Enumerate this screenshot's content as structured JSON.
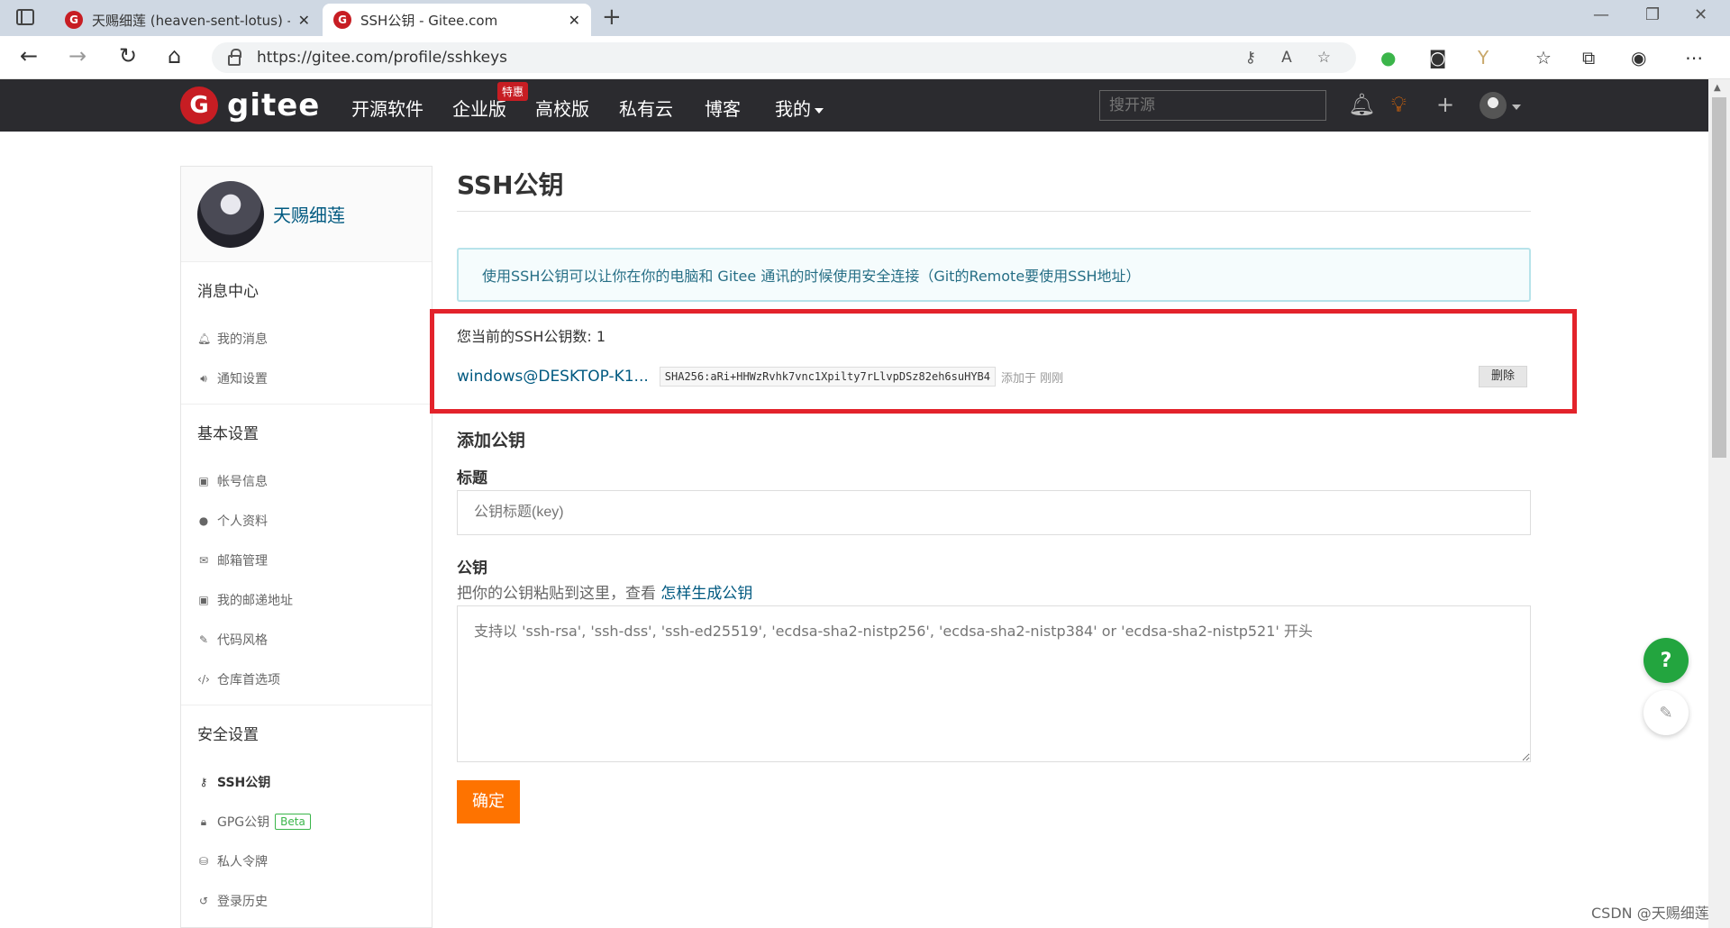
{
  "browser": {
    "tabs": [
      {
        "favicon": "G",
        "title": "天赐细莲 (heaven-sent-lotus) - G"
      },
      {
        "favicon": "G",
        "title": "SSH公钥 - Gitee.com"
      }
    ],
    "url": "https://gitee.com/profile/sshkeys"
  },
  "header": {
    "logo_text": "gitee",
    "nav": [
      "开源软件",
      "企业版",
      "高校版",
      "私有云",
      "博客",
      "我的"
    ],
    "enterprise_badge": "特惠",
    "search_placeholder": "搜开源"
  },
  "sidebar": {
    "username": "天赐细莲",
    "sections": [
      {
        "title": "消息中心",
        "items": [
          "我的消息",
          "通知设置"
        ]
      },
      {
        "title": "基本设置",
        "items": [
          "帐号信息",
          "个人资料",
          "邮箱管理",
          "我的邮递地址",
          "代码风格",
          "仓库首选项"
        ]
      },
      {
        "title": "安全设置",
        "items": [
          "SSH公钥",
          "GPG公钥",
          "私人令牌",
          "登录历史"
        ]
      }
    ],
    "beta_label": "Beta"
  },
  "main": {
    "title": "SSH公钥",
    "info": "使用SSH公钥可以让你在你的电脑和 Gitee 通讯的时候使用安全连接（Git的Remote要使用SSH地址）",
    "key_count_text": "您当前的SSH公钥数: 1",
    "key": {
      "name": "windows@DESKTOP-K1...",
      "fingerprint": "SHA256:aRi+HHWzRvhk7vnc1Xpilty7rLlvpDSz82eh6suHYB4",
      "added": "添加于 刚刚",
      "delete_label": "删除"
    },
    "add_title": "添加公钥",
    "title_label": "标题",
    "title_placeholder": "公钥标题(key)",
    "key_label": "公钥",
    "hint_text": "把你的公钥粘贴到这里，查看",
    "hint_link": "怎样生成公钥",
    "key_placeholder": "支持以 'ssh-rsa', 'ssh-dss', 'ssh-ed25519', 'ecdsa-sha2-nistp256', 'ecdsa-sha2-nistp384' or 'ecdsa-sha2-nistp521' 开头",
    "submit_label": "确定"
  },
  "floating": {
    "help": "?"
  },
  "watermark": "CSDN @天赐细莲"
}
